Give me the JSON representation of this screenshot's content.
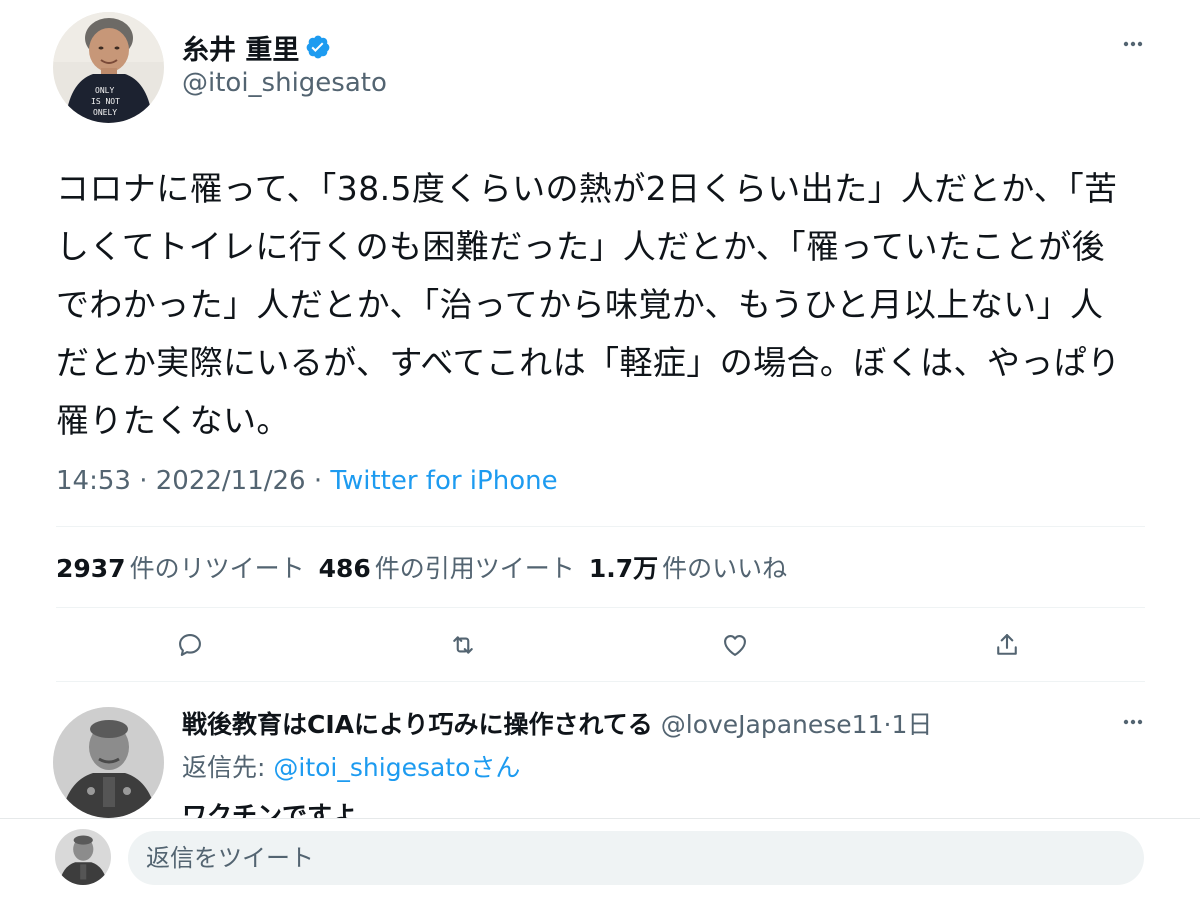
{
  "tweet": {
    "author": {
      "name": "糸井 重里",
      "handle": "@itoi_shigesato",
      "verified": true,
      "avatar_shirt_text": [
        "ONLY",
        "IS NOT",
        "ONELY"
      ]
    },
    "text": "コロナに罹って、「38.5度くらいの熱が2日くらい出た」人だとか、「苦しくてトイレに行くのも困難だった」人だとか、「罹っていたことが後でわかった」人だとか、「治ってから味覚か、もうひと月以上ない」人だとか実際にいるが、すべてこれは「軽症」の場合。ぼくは、やっぱり罹りたくない。",
    "time": "14:53",
    "date": "2022/11/26",
    "separator": "·",
    "source": "Twitter for iPhone",
    "stats": {
      "retweets_count": "2937",
      "retweets_label": "件のリツイート",
      "quotes_count": "486",
      "quotes_label": "件の引用ツイート",
      "likes_count": "1.7万",
      "likes_label": "件のいいね"
    },
    "actions": [
      "reply-icon",
      "retweet-icon",
      "like-icon",
      "share-icon"
    ]
  },
  "reply": {
    "name": "戦後教育はCIAにより巧みに操作されてる",
    "handle": "@loveJapanese11",
    "age": "1日",
    "reply_to_prefix": "返信先:",
    "reply_to_mention": "@itoi_shigesato",
    "reply_to_suffix": "さん",
    "text": "ワクチンですよ"
  },
  "composer": {
    "placeholder": "返信をツイート"
  },
  "colors": {
    "text": "#0f1419",
    "secondary": "#536471",
    "accent": "#1d9bf0",
    "divider": "#eff3f4",
    "input_bg": "#eff3f4"
  }
}
